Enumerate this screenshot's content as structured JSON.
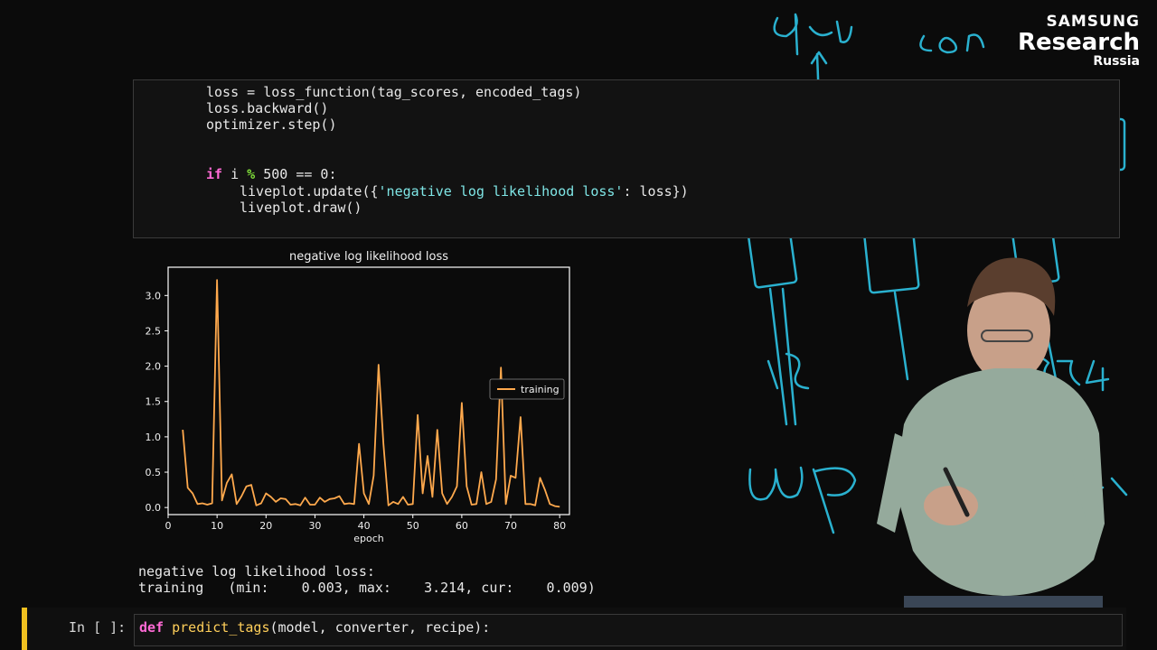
{
  "logo": {
    "line1": "SAMSUNG",
    "line2": "Research",
    "line3": "Russia"
  },
  "code_cell": {
    "line1": "loss = loss_function(tag_scores, encoded_tags)",
    "line2": "loss.backward()",
    "line3": "optimizer.step()",
    "line4_kw": "if",
    "line4_a": " i ",
    "line4_op": "%",
    "line4_b": " 500 == 0:",
    "line5_a": "liveplot.update({",
    "line5_str": "'negative log likelihood loss'",
    "line5_b": ": loss})",
    "line6": "liveplot.draw()"
  },
  "chart_data": {
    "type": "line",
    "title": "negative log likelihood loss",
    "xlabel": "epoch",
    "ylabel": "",
    "xlim": [
      0,
      82
    ],
    "ylim": [
      -0.1,
      3.4
    ],
    "xticks": [
      0,
      10,
      20,
      30,
      40,
      50,
      60,
      70,
      80
    ],
    "yticks": [
      0.0,
      0.5,
      1.0,
      1.5,
      2.0,
      2.5,
      3.0
    ],
    "legend_position": "right",
    "grid": false,
    "series": [
      {
        "name": "training",
        "color": "#ffa94d",
        "x": [
          3,
          4,
          5,
          6,
          7,
          8,
          9,
          10,
          11,
          12,
          13,
          14,
          15,
          16,
          17,
          18,
          19,
          20,
          21,
          22,
          23,
          24,
          25,
          26,
          27,
          28,
          29,
          30,
          31,
          32,
          33,
          34,
          35,
          36,
          37,
          38,
          39,
          40,
          41,
          42,
          43,
          44,
          45,
          46,
          47,
          48,
          49,
          50,
          51,
          52,
          53,
          54,
          55,
          56,
          57,
          58,
          59,
          60,
          61,
          62,
          63,
          64,
          65,
          66,
          67,
          68,
          69,
          70,
          71,
          72,
          73,
          74,
          75,
          76,
          77,
          78,
          79,
          80
        ],
        "values": [
          1.1,
          0.28,
          0.2,
          0.05,
          0.06,
          0.04,
          0.06,
          3.22,
          0.1,
          0.35,
          0.47,
          0.05,
          0.16,
          0.3,
          0.32,
          0.03,
          0.06,
          0.2,
          0.15,
          0.08,
          0.13,
          0.12,
          0.04,
          0.05,
          0.03,
          0.14,
          0.04,
          0.04,
          0.14,
          0.08,
          0.12,
          0.13,
          0.16,
          0.05,
          0.06,
          0.05,
          0.9,
          0.2,
          0.05,
          0.45,
          2.02,
          0.9,
          0.03,
          0.08,
          0.05,
          0.15,
          0.04,
          0.05,
          1.31,
          0.2,
          0.73,
          0.15,
          1.1,
          0.2,
          0.05,
          0.15,
          0.3,
          1.48,
          0.3,
          0.04,
          0.05,
          0.5,
          0.05,
          0.08,
          0.4,
          1.98,
          0.05,
          0.45,
          0.42,
          1.28,
          0.05,
          0.05,
          0.03,
          0.42,
          0.25,
          0.05,
          0.02,
          0.01
        ]
      }
    ]
  },
  "output": {
    "line1": "negative log likelihood loss:",
    "line2": "training   (min:    0.003, max:    3.214, cur:    0.009)"
  },
  "next_cell": {
    "prompt": "In [ ]:",
    "kw": "def",
    "fn": "predict_tags",
    "rest": "(model, converter, recipe):"
  }
}
